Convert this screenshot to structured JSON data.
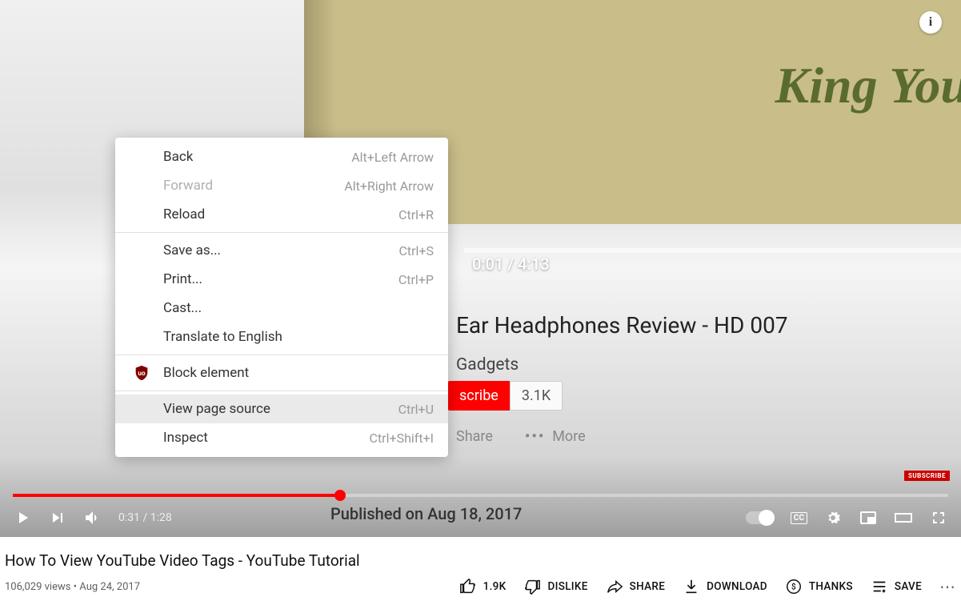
{
  "video": {
    "info_icon": "i",
    "inner_brand": "King You",
    "inner_time": "0:01 / 4:13",
    "inner_title": "Ear Headphones Review - HD 007",
    "inner_channel": "Gadgets",
    "inner_subscribe": "scribe",
    "inner_sub_count": "3.1K",
    "inner_share": "Share",
    "inner_more": "More",
    "inner_published": "Published on Aug 18, 2017",
    "subscribe_badge": "SUBSCRIBE"
  },
  "context_menu": [
    {
      "label": "Back",
      "shortcut": "Alt+Left Arrow",
      "disabled": false
    },
    {
      "label": "Forward",
      "shortcut": "Alt+Right Arrow",
      "disabled": true
    },
    {
      "label": "Reload",
      "shortcut": "Ctrl+R",
      "disabled": false
    },
    {
      "sep": true
    },
    {
      "label": "Save as...",
      "shortcut": "Ctrl+S",
      "disabled": false
    },
    {
      "label": "Print...",
      "shortcut": "Ctrl+P",
      "disabled": false
    },
    {
      "label": "Cast...",
      "shortcut": "",
      "disabled": false
    },
    {
      "label": "Translate to English",
      "shortcut": "",
      "disabled": false
    },
    {
      "sep": true
    },
    {
      "label": "Block element",
      "shortcut": "",
      "disabled": false,
      "icon": "ublock"
    },
    {
      "sep": true
    },
    {
      "label": "View page source",
      "shortcut": "Ctrl+U",
      "disabled": false,
      "highlight": true
    },
    {
      "label": "Inspect",
      "shortcut": "Ctrl+Shift+I",
      "disabled": false
    }
  ],
  "player": {
    "current": "0:31",
    "duration": "1:28",
    "time_text": "0:31 / 1:28"
  },
  "meta": {
    "title": "How To View YouTube Video Tags - YouTube Tutorial",
    "views_date": "106,029 views • Aug 24, 2017"
  },
  "actions": {
    "like_count": "1.9K",
    "dislike": "DISLIKE",
    "share": "SHARE",
    "download": "DOWNLOAD",
    "thanks": "THANKS",
    "save": "SAVE"
  }
}
